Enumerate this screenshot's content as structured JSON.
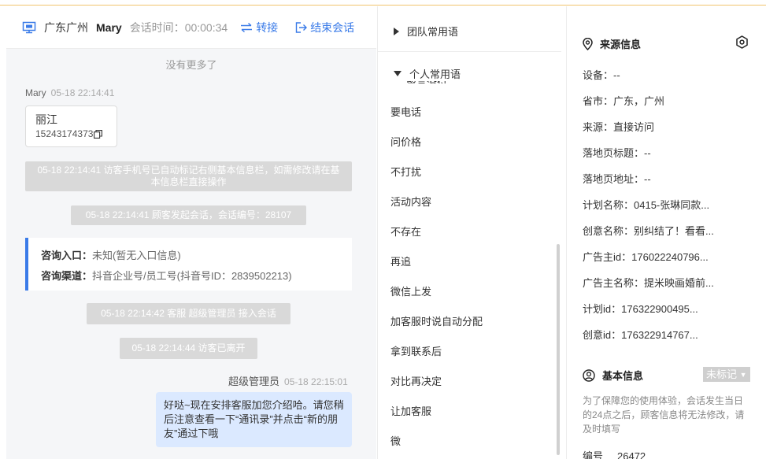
{
  "chat": {
    "header": {
      "location": "广东广州",
      "name": "Mary",
      "duration_label": "会话时间：",
      "duration": "00:00:34",
      "transfer_label": "转接",
      "end_label": "结束会话"
    },
    "no_more": "没有更多了",
    "visitor_sender": "Mary",
    "visitor_time": "05-18 22:14:41",
    "card": {
      "title": "丽江",
      "phone": "15243174373"
    },
    "system": [
      "05-18 22:14:41 访客手机号已自动标记右侧基本信息栏，如需修改请在基本信息栏直接操作",
      "05-18 22:14:41 顾客发起会话，会话编号：28107",
      "05-18 22:14:42 客服 超级管理员 接入会话",
      "05-18 22:14:44 访客已离开"
    ],
    "consult": {
      "entry_label": "咨询入口：",
      "entry_value": "未知(暂无入口信息)",
      "channel_label": "咨询渠道：",
      "channel_value": "抖音企业号/员工号(抖音号ID：2839502213)"
    },
    "agent_sender": "超级管理员",
    "agent_time": "05-18 22:15:01",
    "agent_message": "好哒~现在安排客服加您介绍哈。请您稍后注意查看一下“通讯录”并点击“新的朋友”通过下哦"
  },
  "phrases": {
    "team_group": "团队常用语",
    "personal_group": "个人常用语",
    "partial_item": "留言没付",
    "items": [
      "要电话",
      "问价格",
      "不打扰",
      "活动内容",
      "不存在",
      "再追",
      "微信上发",
      "加客服时说自动分配",
      "拿到联系后",
      "对比再决定",
      "让加客服",
      "微"
    ]
  },
  "info": {
    "source_title": "来源信息",
    "fields": [
      {
        "label": "设备：",
        "value": "--"
      },
      {
        "label": "省市：",
        "value": "广东，广州"
      },
      {
        "label": "来源：",
        "value": "直接访问"
      },
      {
        "label": "落地页标题：",
        "value": "--"
      },
      {
        "label": "落地页地址：",
        "value": "--"
      },
      {
        "label": "计划名称：",
        "value": "0415-张琳同款..."
      },
      {
        "label": "创意名称：",
        "value": "别纠结了！看看..."
      },
      {
        "label": "广告主id：",
        "value": "176022240796..."
      },
      {
        "label": "广告主名称：",
        "value": "提米映画婚前..."
      },
      {
        "label": "计划id：",
        "value": "176322900495..."
      },
      {
        "label": "创意id：",
        "value": "176322914767..."
      }
    ],
    "basic_title": "基本信息",
    "mark_status": "未标记",
    "note": "为了保障您的使用体验，会话发生当日的24点之后，顾客信息将无法修改，请及时填写",
    "number_label": "编号",
    "number_value": "26472"
  },
  "colors": {
    "accent": "#3a7be8",
    "system_bubble": "#d9d9d9",
    "agent_bubble": "#dbe9ff",
    "background": "#f5f6f8"
  }
}
